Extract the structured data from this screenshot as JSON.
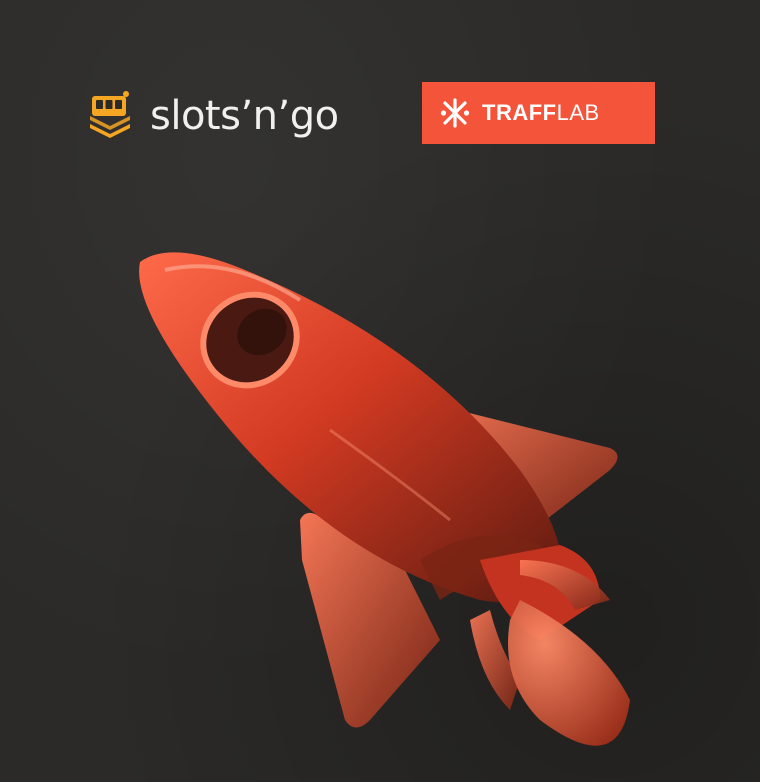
{
  "logos": {
    "slots": {
      "wordmark": "slots’n’go",
      "icon": "slot-machine-icon",
      "color": "#f5a623"
    },
    "trafflab": {
      "word_bold": "TRAFF",
      "word_light": "LAB",
      "icon": "snowflake-cross-icon",
      "background": "#f4543a"
    }
  },
  "illustration": {
    "subject": "rocket",
    "color": "#f4543a"
  }
}
